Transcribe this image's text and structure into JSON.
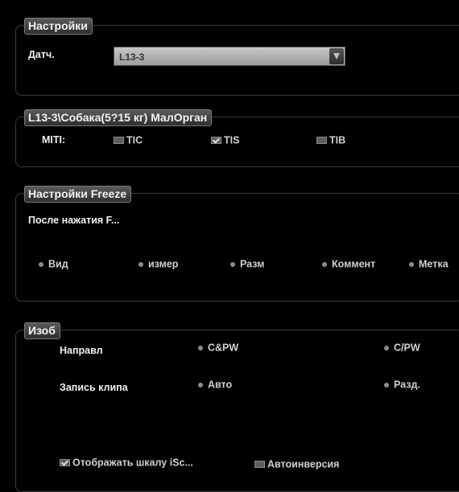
{
  "settings": {
    "legend": "Настройки",
    "probe_label": "Датч.",
    "probe_value": "L13-3"
  },
  "miti": {
    "legend": "L13-3\\Собака(5?15 кг) МалОрган",
    "label": "MITI:",
    "tic": {
      "label": "TIC",
      "checked": false
    },
    "tis": {
      "label": "TIS",
      "checked": true
    },
    "tib": {
      "label": "TIB",
      "checked": false
    }
  },
  "freeze": {
    "legend": "Настройки Freeze",
    "after_press": "После нажатия F...",
    "options": [
      "Вид",
      "измер",
      "Разм",
      "Коммент",
      "Метка"
    ]
  },
  "image": {
    "legend": "Изоб",
    "direction_label": "Направл",
    "direction_options": [
      "C&PW",
      "C/PW"
    ],
    "clip_label": "Запись клипа",
    "clip_options": [
      "Авто",
      "Разд."
    ],
    "show_iscale": {
      "label": "Отображать шкалу iSc...",
      "checked": true
    },
    "auto_invert": {
      "label": "Автоинверсия",
      "checked": false
    }
  }
}
